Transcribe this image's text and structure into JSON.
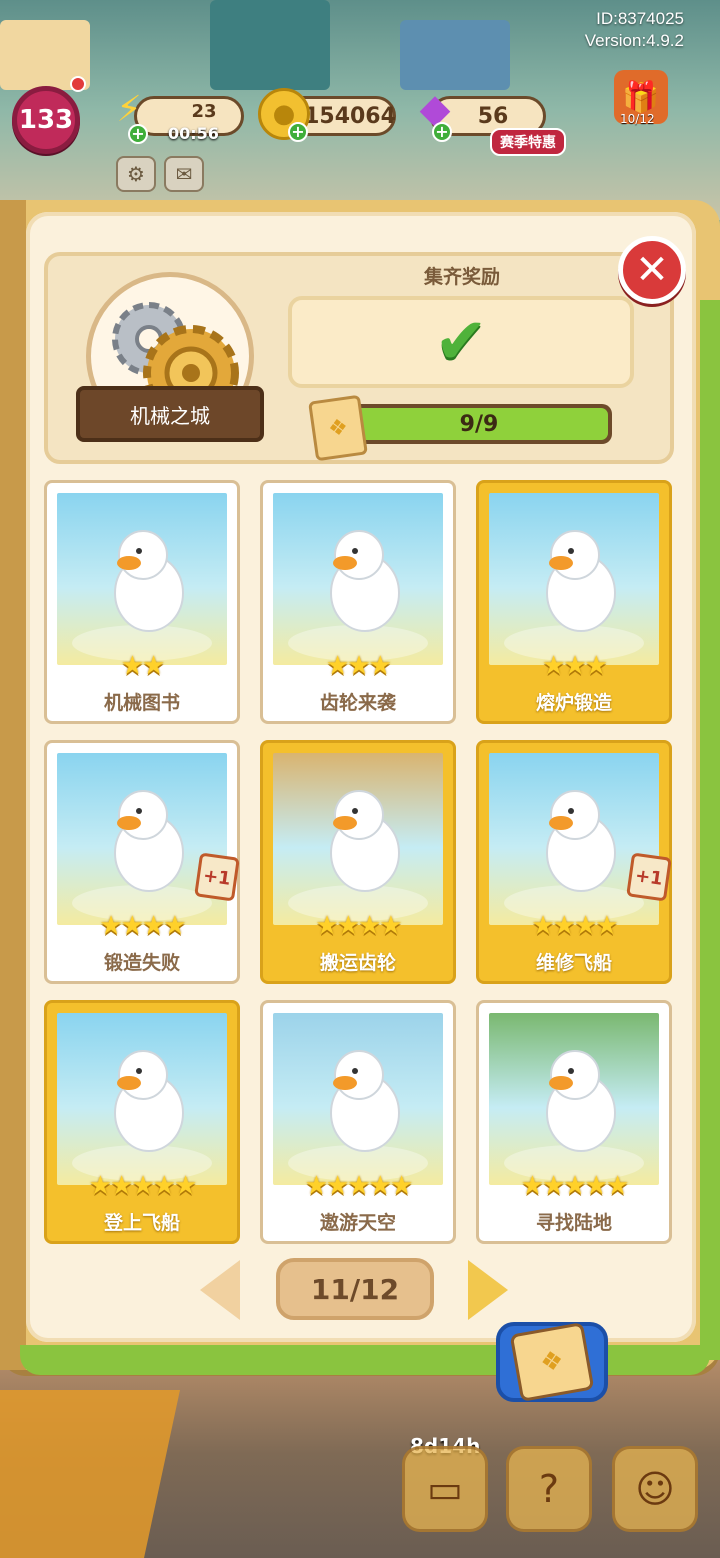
{
  "hud": {
    "player_id": "ID:8374025",
    "version": "Version:4.9.2",
    "level": "133",
    "energy": "23",
    "energy_timer": "00:56",
    "coins": "154064",
    "gems": "56",
    "season_label": "赛季特惠",
    "gift_progress": "10/12"
  },
  "album": {
    "set_name": "机械之城",
    "reward_title": "集齐奖励",
    "reward_claimed": true,
    "progress_text": "9/9",
    "progress_fraction": 1.0,
    "page_indicator": "11/12"
  },
  "cards": [
    {
      "name": "机械图书",
      "stars": "★★",
      "gold": false,
      "dupe": ""
    },
    {
      "name": "齿轮来袭",
      "stars": "★★★",
      "gold": false,
      "dupe": ""
    },
    {
      "name": "熔炉锻造",
      "stars": "★★★",
      "gold": true,
      "dupe": ""
    },
    {
      "name": "锻造失败",
      "stars": "★★★★",
      "gold": false,
      "dupe": "+1"
    },
    {
      "name": "搬运齿轮",
      "stars": "★★★★",
      "gold": true,
      "dupe": ""
    },
    {
      "name": "维修飞船",
      "stars": "★★★★",
      "gold": true,
      "dupe": "+1"
    },
    {
      "name": "登上飞船",
      "stars": "★★★★★",
      "gold": true,
      "dupe": ""
    },
    {
      "name": "遨游天空",
      "stars": "★★★★★",
      "gold": false,
      "dupe": ""
    },
    {
      "name": "寻找陆地",
      "stars": "★★★★★",
      "gold": false,
      "dupe": ""
    }
  ],
  "bottom": {
    "countdown": "8d14h"
  },
  "colors": {
    "gold_card": "#f4c02c",
    "progress_fill": "#8fd13b",
    "close_red": "#d93a3a",
    "star": "#ffd12a"
  }
}
